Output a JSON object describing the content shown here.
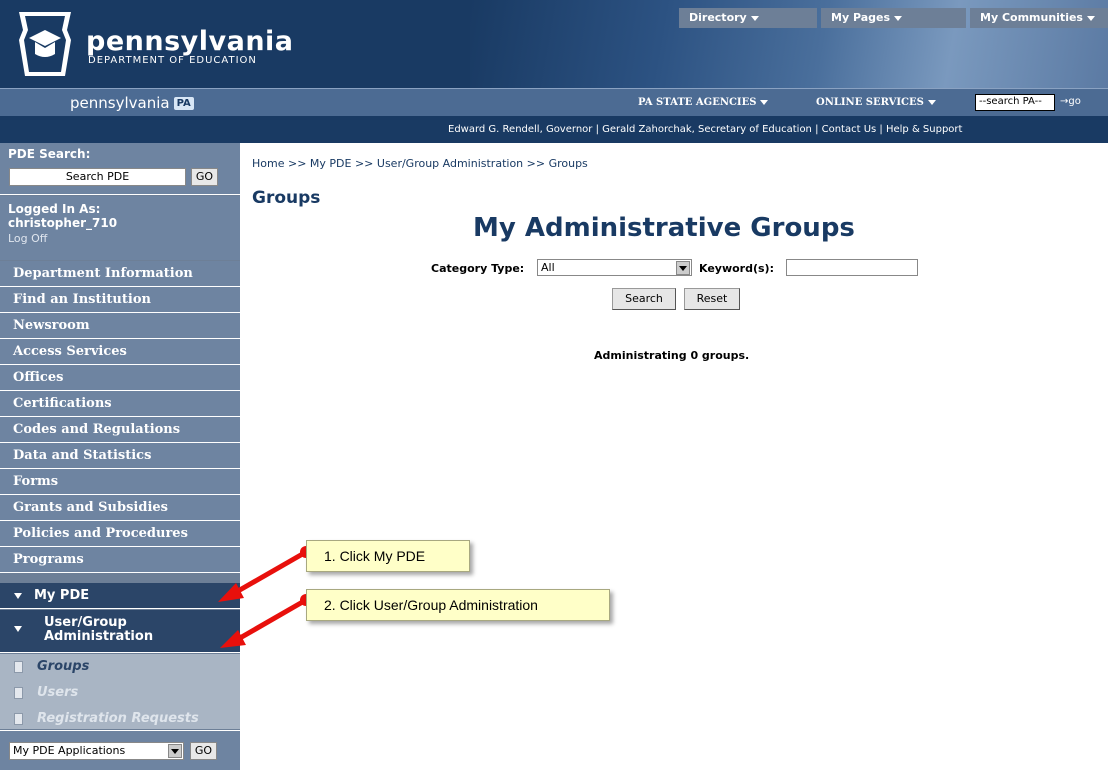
{
  "header": {
    "logo_title": "pennsylvania",
    "logo_subtitle": "DEPARTMENT OF EDUCATION",
    "top_nav": [
      "Directory",
      "My Pages",
      "My Communities"
    ],
    "pa_logo_text": "pennsylvania",
    "pa_badge": "PA",
    "agencies_link": "PA STATE AGENCIES",
    "services_link": "ONLINE SERVICES",
    "pa_search_placeholder": "--search PA--",
    "pa_go": "→go",
    "officials_line": "Edward G. Rendell, Governor | Gerald Zahorchak, Secretary of Education | Contact Us | Help & Support"
  },
  "sidebar": {
    "search_label": "PDE Search:",
    "search_placeholder": "Search PDE",
    "go_label": "GO",
    "logged_in_label": "Logged In As:",
    "username": "christopher_710",
    "log_off": "Log Off",
    "nav_items": [
      "Department Information",
      "Find an Institution",
      "Newsroom",
      "Access Services",
      "Offices",
      "Certifications",
      "Codes and Regulations",
      "Data and Statistics",
      "Forms",
      "Grants and Subsidies",
      "Policies and Procedures",
      "Programs"
    ],
    "my_pde": "My PDE",
    "user_group_admin_line1": "User/Group",
    "user_group_admin_line2": "Administration",
    "sub_items": [
      "Groups",
      "Users",
      "Registration Requests"
    ],
    "apps_select": "My PDE Applications",
    "apps_go": "GO"
  },
  "main": {
    "breadcrumb": "Home >> My PDE >> User/Group Administration >> Groups",
    "page_title": "Groups",
    "heading": "My Administrative Groups",
    "category_label": "Category Type:",
    "category_value": "All",
    "keyword_label": "Keyword(s):",
    "keyword_value": "",
    "search_button": "Search",
    "reset_button": "Reset",
    "admin_count": "Administrating 0 groups."
  },
  "callouts": {
    "step1": "1. Click My PDE",
    "step2": "2. Click User/Group Administration",
    "arrow_color": "#e8100c"
  }
}
